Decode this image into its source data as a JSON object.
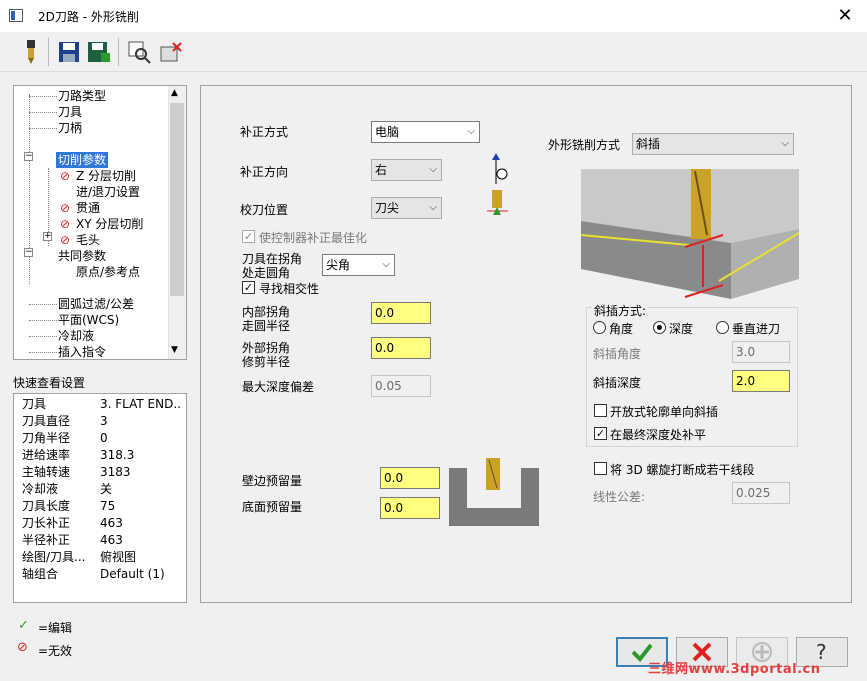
{
  "window": {
    "title": "2D刀路 - 外形铣削",
    "close": "✕"
  },
  "tree": {
    "items": [
      "刀路类型",
      "刀具",
      "刀柄",
      "切削参数",
      "Z 分层切削",
      "进/退刀设置",
      "贯通",
      "XY 分层切削",
      "毛头",
      "共同参数",
      "原点/参考点",
      "圆弧过滤/公差",
      "平面(WCS)",
      "冷却液",
      "插入指令"
    ]
  },
  "quick": {
    "title": "快速查看设置",
    "rows": [
      {
        "k": "刀具",
        "v": "3. FLAT END..."
      },
      {
        "k": "刀具直径",
        "v": "3"
      },
      {
        "k": "刀角半径",
        "v": "0"
      },
      {
        "k": "进给速率",
        "v": "318.3"
      },
      {
        "k": "主轴转速",
        "v": "3183"
      },
      {
        "k": "冷却液",
        "v": "关"
      },
      {
        "k": "刀具长度",
        "v": "75"
      },
      {
        "k": "刀长补正",
        "v": "463"
      },
      {
        "k": "半径补正",
        "v": "463"
      },
      {
        "k": "绘图/刀具...",
        "v": "俯视图"
      },
      {
        "k": "轴组合",
        "v": "Default (1)"
      }
    ]
  },
  "legend": {
    "edit": "=编辑",
    "invalid": "=无效"
  },
  "params": {
    "comp_type_label": "补正方式",
    "comp_type": "电脑",
    "comp_dir_label": "补正方向",
    "comp_dir": "右",
    "tip_comp_label": "校刀位置",
    "tip_comp": "刀尖",
    "optimize_label": "使控制器补正最佳化",
    "corner_label_1": "刀具在拐角",
    "corner_label_2": "处走圆角",
    "corner": "尖角",
    "find_intersect_label": "寻找相交性",
    "inner_corner_1": "内部拐角",
    "inner_corner_2": "走圆半径",
    "inner_corner": "0.0",
    "outer_corner_1": "外部拐角",
    "outer_corner_2": "修剪半径",
    "outer_corner": "0.0",
    "max_depth_label": "最大深度偏差",
    "max_depth": "0.05",
    "wall_stock_label": "壁边预留量",
    "wall_stock": "0.0",
    "floor_stock_label": "底面预留量",
    "floor_stock": "0.0",
    "contour_type_label": "外形铣削方式",
    "contour_type": "斜插",
    "ramp_group_label": "斜插方式:",
    "ramp_angle_opt": "角度",
    "ramp_depth_opt": "深度",
    "ramp_plunge_opt": "垂直进刀",
    "ramp_angle_label": "斜插角度",
    "ramp_angle": "3.0",
    "ramp_depth_label": "斜插深度",
    "ramp_depth": "2.0",
    "open_contour_label": "开放式轮廓单向斜插",
    "final_depth_label": "在最终深度处补平",
    "helix_label": "将 3D 螺旋打断成若干线段",
    "linear_tol_label": "线性公差:",
    "linear_tol": "0.025"
  },
  "watermark": "三维网www.3dportal.cn",
  "colors": {
    "accent": "#3078d8",
    "input_highlight": "#ffff80",
    "invalid": "#e02020",
    "valid": "#2a9a2a"
  }
}
